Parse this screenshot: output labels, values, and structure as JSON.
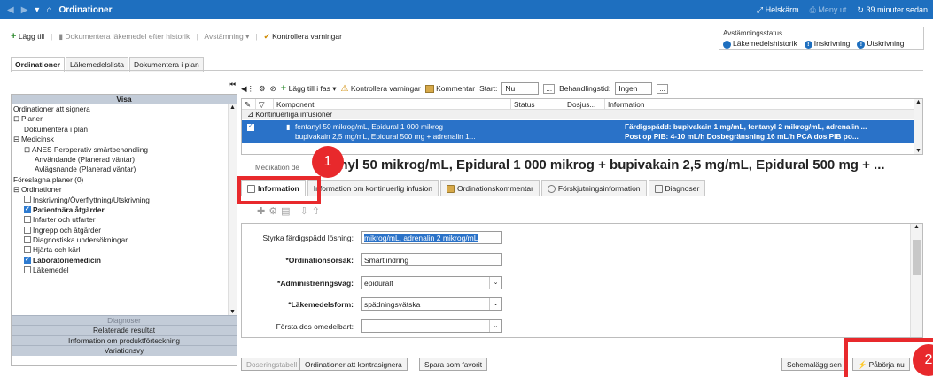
{
  "titlebar": {
    "title": "Ordinationer",
    "fullscreen": "Helskärm",
    "menu": "Meny ut",
    "refresh": "39 minuter sedan"
  },
  "toolbar": {
    "add": "Lägg till",
    "document_history": "Dokumentera läkemedel efter historik",
    "reconcile": "Avstämning",
    "check_warnings": "Kontrollera varningar"
  },
  "reconcile_status": {
    "label": "Avstämningsstatus",
    "links": [
      "Läkemedelshistorik",
      "Inskrivning",
      "Utskrivning"
    ]
  },
  "main_tabs": [
    "Ordinationer",
    "Läkemedelslista",
    "Dokumentera i plan"
  ],
  "left_panel": {
    "header": "Visa",
    "tree": [
      {
        "text": "Ordinationer att signera",
        "indent": 0,
        "cb": "",
        "bold": false
      },
      {
        "text": "Planer",
        "indent": 0,
        "cb": "minus",
        "bold": false
      },
      {
        "text": "Dokumentera i plan",
        "indent": 1,
        "cb": "",
        "bold": false
      },
      {
        "text": "Medicinsk",
        "indent": 0,
        "cb": "minus",
        "bold": false
      },
      {
        "text": "ANES Peroperativ smärtbehandling",
        "indent": 1,
        "cb": "minus",
        "bold": false
      },
      {
        "text": "Användande (Planerad väntar)",
        "indent": 2,
        "cb": "",
        "bold": false
      },
      {
        "text": "Avlägsnande (Planerad väntar)",
        "indent": 2,
        "cb": "",
        "bold": false
      },
      {
        "text": "Föreslagna planer (0)",
        "indent": 0,
        "cb": "",
        "bold": false
      },
      {
        "text": "Ordinationer",
        "indent": 0,
        "cb": "minus",
        "bold": false
      },
      {
        "text": "Inskrivning/Överflyttning/Utskrivning",
        "indent": 1,
        "cb": "box",
        "bold": false
      },
      {
        "text": "Patientnära åtgärder",
        "indent": 1,
        "cb": "on",
        "bold": true
      },
      {
        "text": "Infarter och utfarter",
        "indent": 1,
        "cb": "box",
        "bold": false
      },
      {
        "text": "Ingrepp och åtgärder",
        "indent": 1,
        "cb": "box",
        "bold": false
      },
      {
        "text": "Diagnostiska undersökningar",
        "indent": 1,
        "cb": "box",
        "bold": false
      },
      {
        "text": "Hjärta och kärl",
        "indent": 1,
        "cb": "box",
        "bold": false
      },
      {
        "text": "Laboratoriemedicin",
        "indent": 1,
        "cb": "on",
        "bold": true
      },
      {
        "text": "Läkemedel",
        "indent": 1,
        "cb": "box",
        "bold": false
      }
    ],
    "footer_bars": [
      "Diagnoser",
      "Relaterade resultat",
      "Information om produktförteckning",
      "Variationsvy"
    ]
  },
  "right_toolbar": {
    "add_to_phase": "Lägg till i fas",
    "check_warnings": "Kontrollera varningar",
    "comment": "Kommentar",
    "start_label": "Start:",
    "start_value": "Nu",
    "duration_label": "Behandlingstid:",
    "duration_value": "Ingen"
  },
  "grid": {
    "columns": [
      "Komponent",
      "Status",
      "Dosjus...",
      "Information"
    ],
    "group": "Kontinuerliga infusioner",
    "row": {
      "component_line1": "fentanyl 50 mikrog/mL, Epidural 1 000 mikrog +",
      "component_line2": "bupivakain 2,5 mg/mL, Epidural 500 mg + adrenalin 1...",
      "info_line1": "Färdigspädd: bupivakain 1 mg/mL, fentanyl 2 mikrog/mL, adrenalin ...",
      "info_line2": "Post op PIB: 4-10 mL/h  Dosbegränsning 16 mL/h  PCA dos  PIB po..."
    }
  },
  "detail": {
    "prefix": "Medikation de",
    "title": "tanyl 50 mikrog/mL, Epidural 1 000 mikrog + bupivakain 2,5 mg/mL, Epidural 500 mg + ...",
    "tabs": [
      "Information",
      "Information om kontinuerlig infusion",
      "Ordinationskommentar",
      "Förskjutningsinformation",
      "Diagnoser"
    ]
  },
  "form": {
    "fields": [
      {
        "label": "Styrka färdigspädd lösning:",
        "value": "mikrog/mL, adrenalin 2 mikrog/mL",
        "required": false,
        "dropdown": false,
        "selected": true
      },
      {
        "label": "*Ordinationsorsak:",
        "value": "Smärtlindring",
        "required": true,
        "dropdown": false,
        "selected": false
      },
      {
        "label": "*Administreringsväg:",
        "value": "epiduralt",
        "required": true,
        "dropdown": true,
        "selected": false
      },
      {
        "label": "*Läkemedelsform:",
        "value": "spädningsvätska",
        "required": true,
        "dropdown": true,
        "selected": false
      },
      {
        "label": "Första dos omedelbart:",
        "value": "",
        "required": false,
        "dropdown": true,
        "selected": false
      }
    ]
  },
  "buttons": {
    "dose_table": "Doseringstabell",
    "to_cosign": "Ordinationer att kontrasignera",
    "save_favorite": "Spara som favorit",
    "schedule": "Schemalägg sen",
    "start_now": "Påbörja nu"
  },
  "annotations": {
    "badge1": "1",
    "badge2": "2",
    "accent": "#e8292c"
  }
}
